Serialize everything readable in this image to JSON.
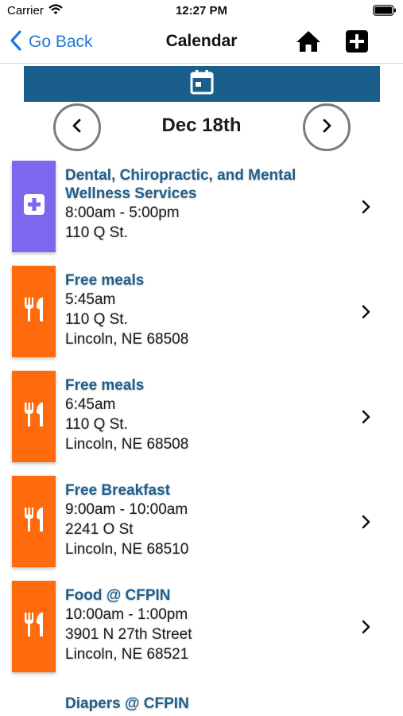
{
  "status_bar": {
    "carrier": "Carrier",
    "time": "12:27 PM",
    "wifi_icon": "wifi-icon",
    "battery_icon": "battery-icon"
  },
  "nav": {
    "back_label": "Go Back",
    "title": "Calendar",
    "home_icon": "home-icon",
    "add_icon": "plus-square-icon",
    "accent_color": "#1f7ad8"
  },
  "calendar_bar": {
    "icon": "calendar-icon",
    "color": "#1a5f8c"
  },
  "date_nav": {
    "label": "Dec 18th",
    "prev_icon": "chevron-left-icon",
    "next_icon": "chevron-right-icon"
  },
  "events": [
    {
      "title": "Dental, Chiropractic, and Mental Wellness Services",
      "lines": [
        "8:00am - 5:00pm",
        "110 Q St."
      ],
      "category_icon": "medical-plus-icon",
      "color": "#7b68ee"
    },
    {
      "title": "Free meals",
      "lines": [
        "5:45am",
        "110 Q St.",
        "Lincoln, NE 68508"
      ],
      "category_icon": "fork-knife-icon",
      "color": "#ff6a0d"
    },
    {
      "title": "Free meals",
      "lines": [
        "6:45am",
        "110 Q St.",
        "Lincoln, NE 68508"
      ],
      "category_icon": "fork-knife-icon",
      "color": "#ff6a0d"
    },
    {
      "title": "Free Breakfast",
      "lines": [
        "9:00am - 10:00am",
        "2241 O St",
        "Lincoln, NE 68510"
      ],
      "category_icon": "fork-knife-icon",
      "color": "#ff6a0d"
    },
    {
      "title": "Food @ CFPIN",
      "lines": [
        "10:00am - 1:00pm",
        "3901 N 27th Street",
        "Lincoln, NE 68521"
      ],
      "category_icon": "fork-knife-icon",
      "color": "#ff6a0d"
    },
    {
      "title": "Diapers @ CFPIN",
      "lines": [],
      "category_icon": "",
      "color": ""
    }
  ]
}
